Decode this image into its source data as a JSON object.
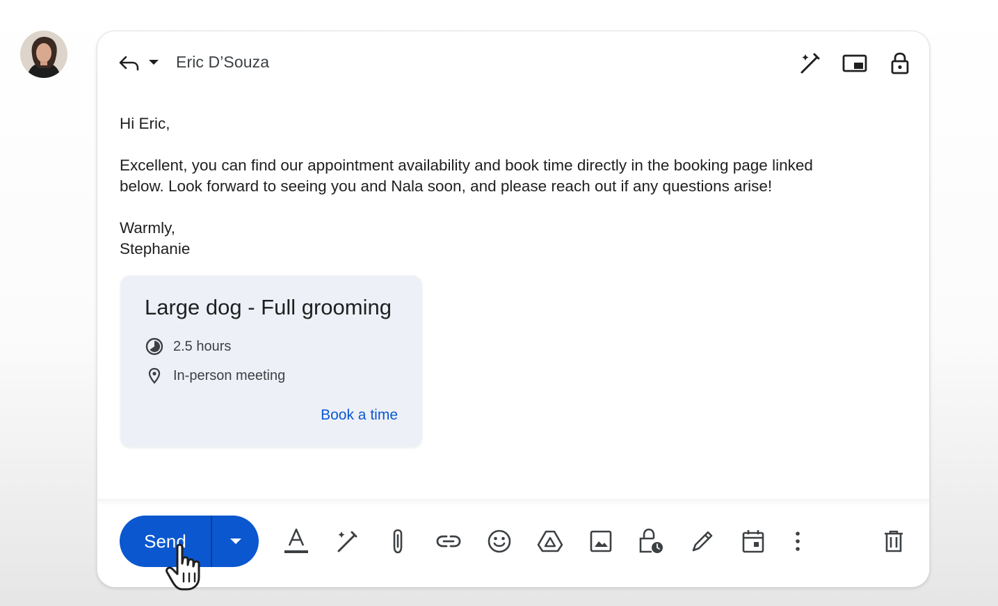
{
  "header": {
    "recipient": "Eric D’Souza",
    "icons": [
      "reply-icon",
      "dropdown-arrow-icon",
      "magic-pen-icon",
      "picture-in-picture-icon",
      "lock-icon"
    ]
  },
  "body": {
    "greeting": "Hi Eric,",
    "paragraph_line1": "Excellent, you can find our appointment availability and book time directly in the booking page linked",
    "paragraph_line2": "below. Look forward to seeing you and Nala soon, and please reach out if any questions arise!",
    "signoff": "Warmly,",
    "signature": "Stephanie"
  },
  "booking_card": {
    "title": "Large dog - Full grooming",
    "duration": "2.5 hours",
    "location": "In-person meeting",
    "link_label": "Book a time"
  },
  "toolbar": {
    "send_label": "Send",
    "icons": [
      "format-text-icon",
      "help-me-write-icon",
      "attach-icon",
      "link-icon",
      "emoji-icon",
      "drive-icon",
      "image-icon",
      "confidential-mode-icon",
      "signature-icon",
      "schedule-event-icon",
      "more-options-icon",
      "delete-icon"
    ]
  },
  "colors": {
    "send_button": "#0b57d0",
    "link": "#0b57d0",
    "card_background": "#edf1f7",
    "text": "#1f1f1f"
  }
}
